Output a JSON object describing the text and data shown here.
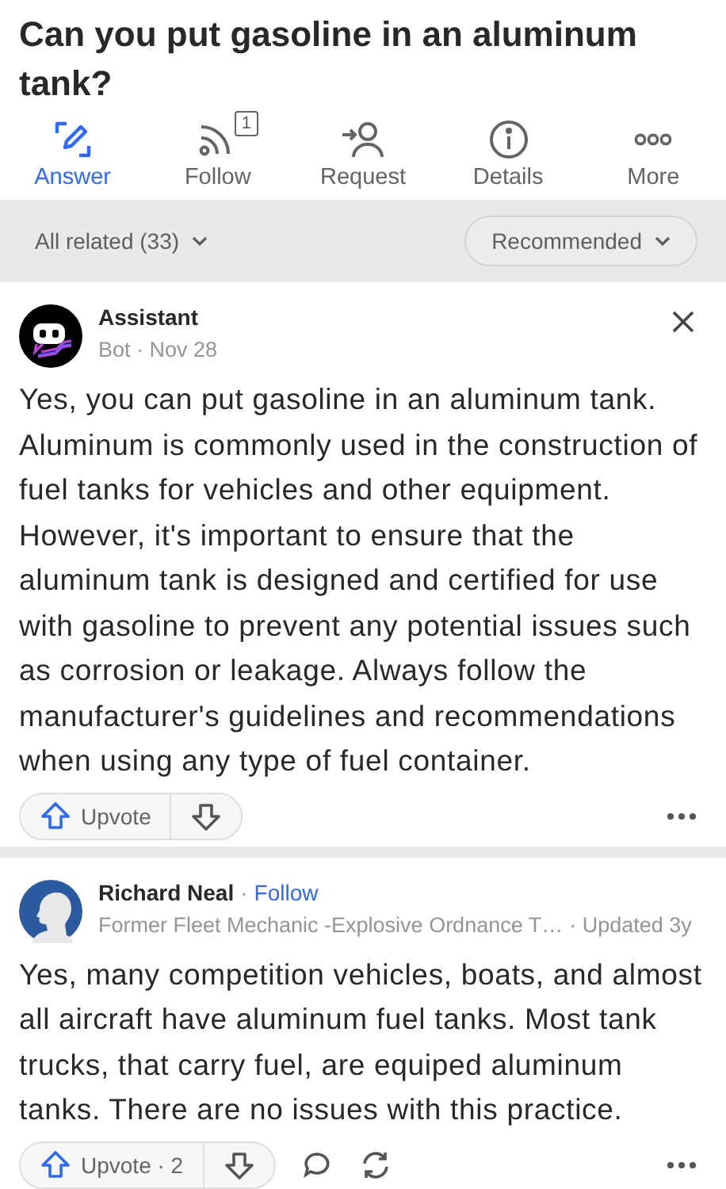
{
  "question": {
    "title": "Can you put gasoline in an aluminum tank?"
  },
  "tabs": [
    {
      "label": "Answer",
      "selected": true
    },
    {
      "label": "Follow",
      "badge": "1",
      "selected": false
    },
    {
      "label": "Request",
      "selected": false
    },
    {
      "label": "Details",
      "selected": false
    },
    {
      "label": "More",
      "selected": false
    }
  ],
  "filter_bar": {
    "related": "All related (33)",
    "sort": "Recommended"
  },
  "answers": [
    {
      "kind": "bot",
      "author": "Assistant",
      "meta": "Bot · Nov 28",
      "dismissable": true,
      "text": "Yes, you can put gasoline in an aluminum tank. Aluminum is commonly used in the construction of fuel tanks for vehicles and other equipment. However, it's important to ensure that the aluminum tank is designed and certified for use with gasoline to prevent any potential issues such as corrosion or leakage. Always follow the manufacturer's guidelines and recommendations when using any type of fuel container.",
      "upvote": "Upvote",
      "social": false
    },
    {
      "kind": "person",
      "author": "Richard Neal",
      "separator": "·",
      "follow": "Follow",
      "credential": "Former Fleet Mechanic -Explosive Ordnance T…",
      "meta": "· Updated 3y",
      "dismissable": false,
      "text": "Yes, many competition vehicles, boats, and almost all aircraft have aluminum fuel tanks. Most tank trucks, that carry fuel, are equiped aluminum tanks. There are no issues with this practice.",
      "upvote": "Upvote · 2",
      "social": true
    }
  ]
}
